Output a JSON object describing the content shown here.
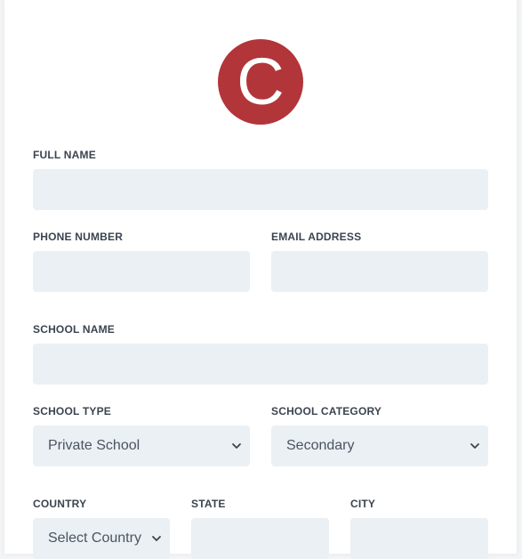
{
  "brand": {
    "logo_letter": "C",
    "logo_color": "#b2353a"
  },
  "form": {
    "full_name_label": "FULL NAME",
    "phone_label": "PHONE NUMBER",
    "email_label": "EMAIL ADDRESS",
    "school_name_label": "SCHOOL NAME",
    "school_type_label": "SCHOOL TYPE",
    "school_type_value": "Private School",
    "school_category_label": "SCHOOL CATEGORY",
    "school_category_value": "Secondary",
    "country_label": "COUNTRY",
    "country_value": "Select Country",
    "state_label": "STATE",
    "city_label": "CITY"
  }
}
